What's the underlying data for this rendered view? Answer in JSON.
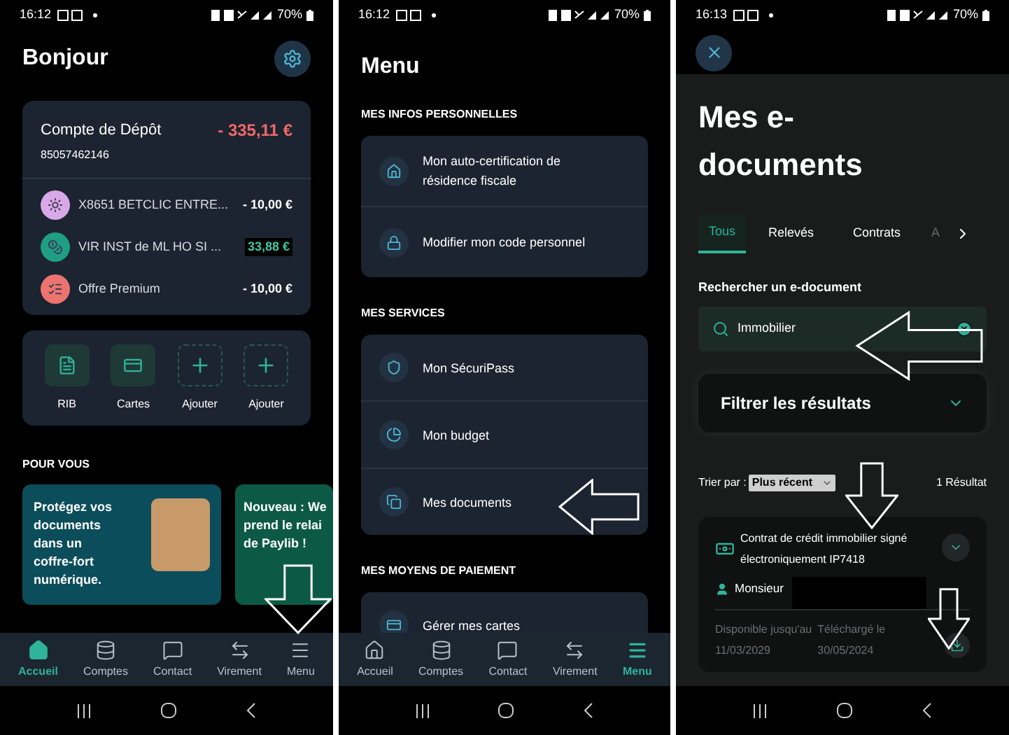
{
  "home_screen": {
    "status_bar": {
      "time": "16:12",
      "battery": "70%"
    },
    "title": "Bonjour",
    "account": {
      "name": "Compte de Dépôt",
      "number": "85057462146",
      "balance": "- 335,11 €",
      "transactions": [
        {
          "label": "X8651 BETCLIC ENTRE...",
          "amount": "- 10,00 €",
          "kind": "debit",
          "color": "#d9a8e8"
        },
        {
          "label": "VIR INST de ML HO SI ...",
          "amount": "33,88 €",
          "kind": "credit",
          "color": "#1f9e85"
        },
        {
          "label": "Offre Premium",
          "amount": "- 10,00 €",
          "kind": "debit",
          "color": "#ec7470"
        }
      ]
    },
    "shortcuts": [
      {
        "label": "RIB",
        "kind": "existing"
      },
      {
        "label": "Cartes",
        "kind": "existing"
      },
      {
        "label": "Ajouter",
        "kind": "add"
      },
      {
        "label": "Ajouter",
        "kind": "add"
      }
    ],
    "section_title": "POUR VOUS",
    "promos": [
      {
        "lines": [
          "Protégez vos",
          "documents",
          "dans un",
          "coffre-fort",
          "numérique."
        ],
        "color": "#0b4d5a",
        "photo": true
      },
      {
        "lines": [
          "Nouveau : We",
          "prend le relai",
          "de Paylib !"
        ],
        "color": "#0c5a45",
        "photo": false
      }
    ],
    "bottom_nav": [
      {
        "label": "Accueil",
        "selected": true
      },
      {
        "label": "Comptes",
        "selected": false
      },
      {
        "label": "Contact",
        "selected": false
      },
      {
        "label": "Virement",
        "selected": false
      },
      {
        "label": "Menu",
        "selected": false
      }
    ]
  },
  "menu_screen": {
    "status_bar": {
      "time": "16:12",
      "battery": "70%"
    },
    "title": "Menu",
    "sections": [
      {
        "title": "MES INFOS PERSONNELLES",
        "items": [
          {
            "label": "Mon auto-certification de résidence fiscale"
          },
          {
            "label": "Modifier mon code personnel"
          }
        ]
      },
      {
        "title": "MES SERVICES",
        "items": [
          {
            "label": "Mon SécuriPass"
          },
          {
            "label": "Mon budget"
          },
          {
            "label": "Mes documents"
          }
        ]
      },
      {
        "title": "MES MOYENS DE PAIEMENT",
        "items": [
          {
            "label": "Gérer mes cartes"
          }
        ]
      }
    ],
    "bottom_nav": [
      {
        "label": "Accueil",
        "selected": false
      },
      {
        "label": "Comptes",
        "selected": false
      },
      {
        "label": "Contact",
        "selected": false
      },
      {
        "label": "Virement",
        "selected": false
      },
      {
        "label": "Menu",
        "selected": true
      }
    ]
  },
  "documents_screen": {
    "status_bar": {
      "time": "16:13",
      "battery": "70%"
    },
    "title": "Mes e-documents",
    "tabs": [
      {
        "label": "Tous",
        "selected": true
      },
      {
        "label": "Relevés",
        "selected": false
      },
      {
        "label": "Contrats",
        "selected": false
      },
      {
        "label": "A",
        "selected": false
      }
    ],
    "search": {
      "label": "Rechercher un e-document",
      "value": "Immobilier"
    },
    "filter": {
      "label": "Filtrer les résultats",
      "expanded": false
    },
    "sort": {
      "label": "Trier par :",
      "value": "Plus récent"
    },
    "result_count": "1 Résultat",
    "results": [
      {
        "title": "Contrat de crédit immobilier signé électroniquement IP7418",
        "holder": "Monsieur",
        "expanded": false,
        "available_label": "Disponible jusqu'au",
        "available_date": "11/03/2029",
        "downloaded_label": "Téléchargé le",
        "downloaded_date": "30/05/2024"
      }
    ]
  }
}
